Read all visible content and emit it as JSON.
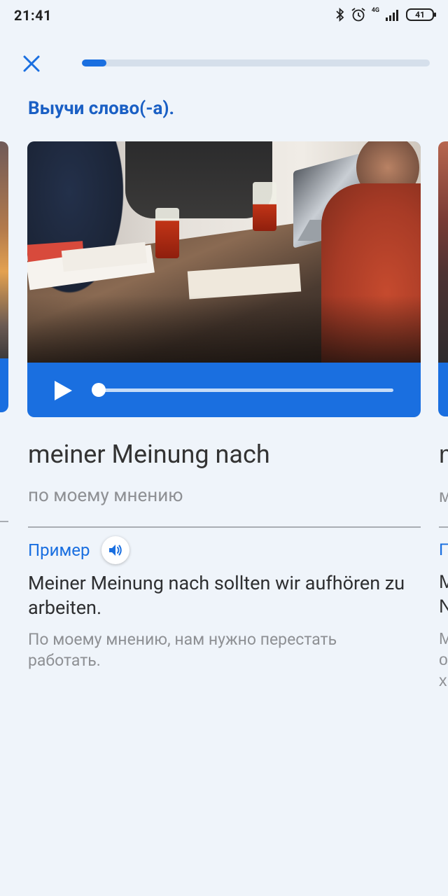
{
  "status_bar": {
    "time": "21:41",
    "network_label": "4G",
    "battery": "41",
    "icons": [
      "bluetooth-icon",
      "alarm-icon",
      "signal-icon",
      "battery-icon"
    ]
  },
  "header": {
    "close_icon": "close-icon",
    "progress_percent": 7
  },
  "heading": "Выучи слово(-а).",
  "card": {
    "image_alt": "photo-people-at-table-icon",
    "player": {
      "play_icon": "play-icon",
      "position_percent": 0
    },
    "word": "meiner Meinung nach",
    "translation": "по моему мнению",
    "example_label": "Пример",
    "speaker_icon": "speaker-icon",
    "example_sentence": "Meiner Meinung nach sollten wir aufhören zu arbeiten.",
    "example_translation": "По моему мнению, нам нужно перестать работать."
  },
  "next_card_peek": {
    "word": "m",
    "translation": "м",
    "example_label": "П",
    "sentence_lines": [
      "M",
      "N"
    ],
    "translation_lines": [
      "M",
      "о",
      "х"
    ]
  },
  "colors": {
    "background": "#eff4fa",
    "accent": "#1a6fe0",
    "heading": "#1a5fc4",
    "muted_text": "#8e9094"
  }
}
